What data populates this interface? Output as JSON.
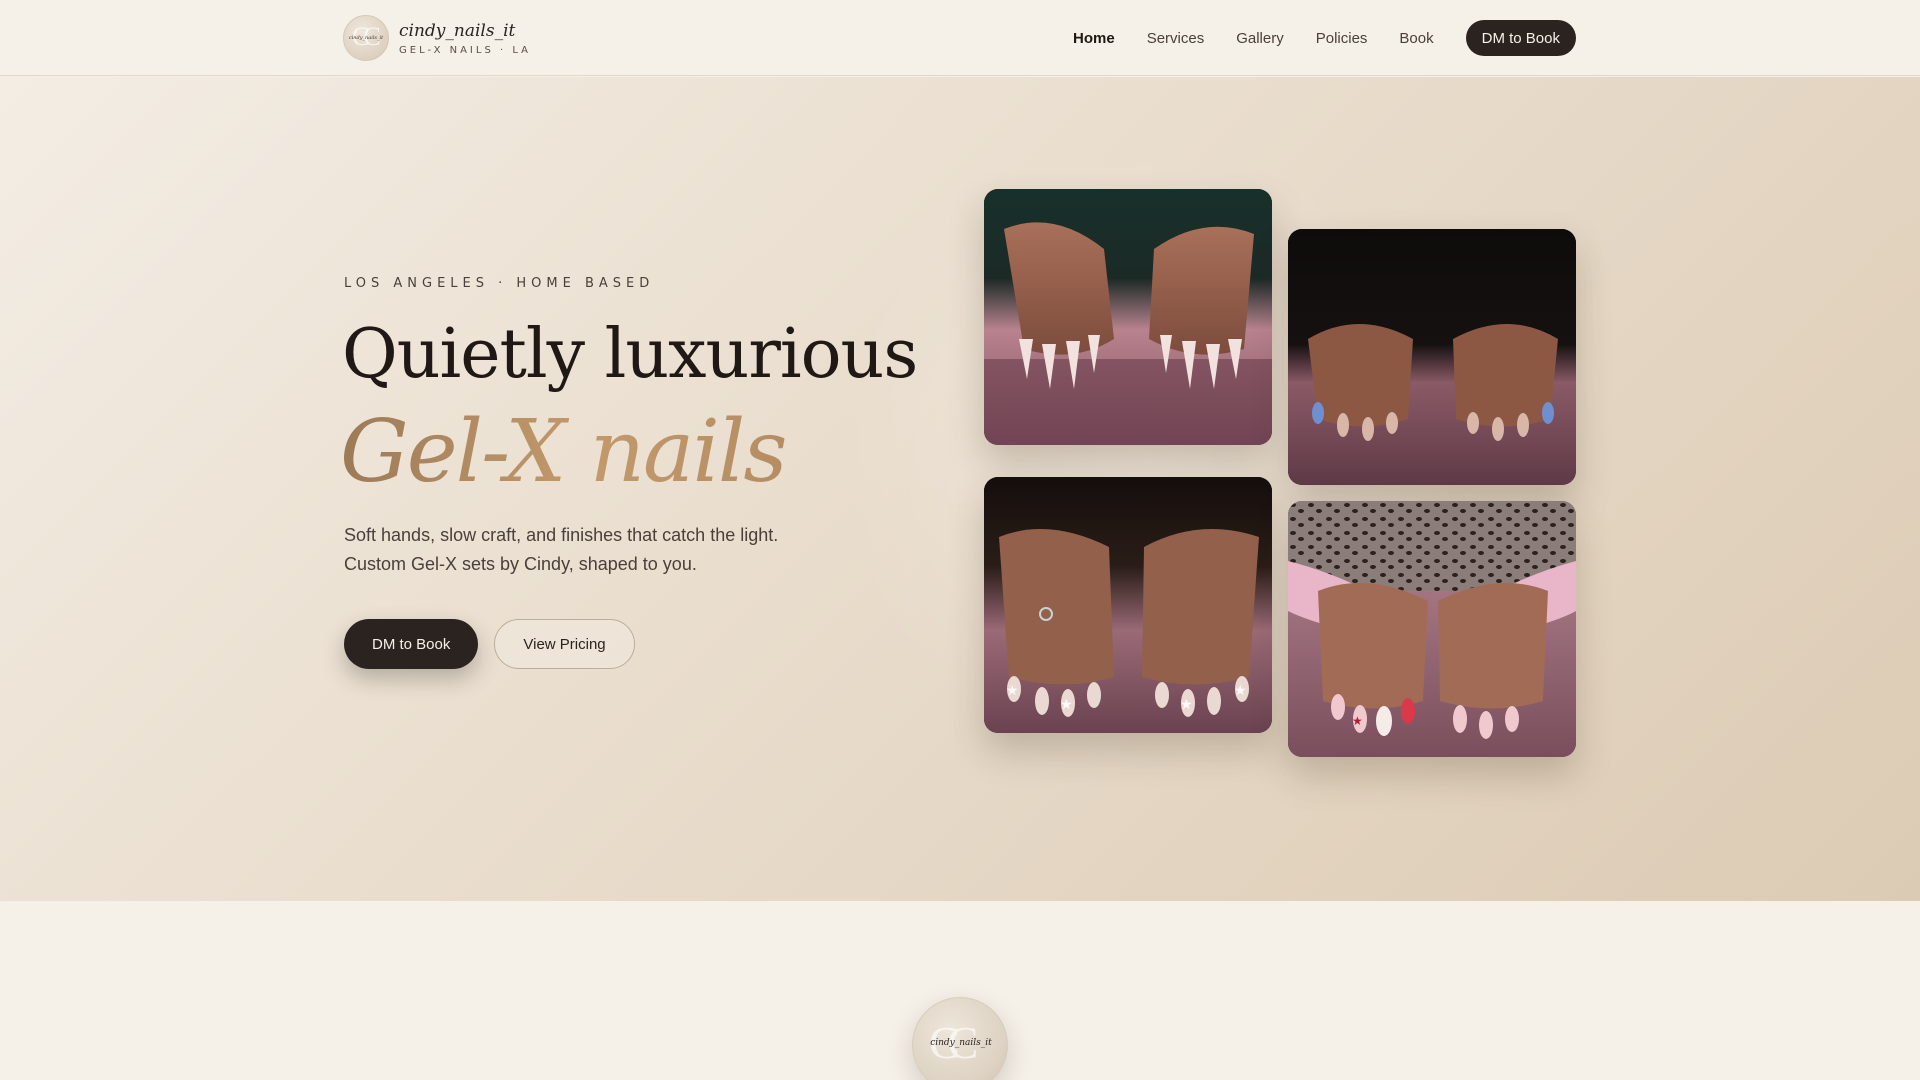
{
  "brand": {
    "logo_text": "cindy_nails_it",
    "logo_monogram": "CC",
    "name": "cindy_nails_it",
    "tagline": "GEL-X NAILS · LA"
  },
  "nav": {
    "items": [
      {
        "label": "Home",
        "active": true
      },
      {
        "label": "Services",
        "active": false
      },
      {
        "label": "Gallery",
        "active": false
      },
      {
        "label": "Policies",
        "active": false
      },
      {
        "label": "Book",
        "active": false
      }
    ],
    "cta_label": "DM to Book"
  },
  "hero": {
    "eyebrow": "LOS ANGELES · HOME BASED",
    "headline": "Quietly luxurious",
    "headline_script": "Gel-X nails",
    "lede": "Soft hands, slow craft, and finishes that catch the light. Custom Gel-X sets by Cindy, shaped to you.",
    "primary_button": "DM to Book",
    "secondary_button": "View Pricing",
    "photos": [
      {
        "alt": "almond-french-tips-nails-photo"
      },
      {
        "alt": "blue-accent-nails-photo"
      },
      {
        "alt": "star-glitter-nails-photo"
      },
      {
        "alt": "pink-red-accent-nails-photo"
      }
    ]
  },
  "section_logo": {
    "logo_text": "cindy_nails_it",
    "logo_monogram": "CC"
  },
  "colors": {
    "dark": "#2b2320",
    "cream": "#f5f0e8",
    "gold": "#c39a6c",
    "tan": "#dccbb4"
  }
}
